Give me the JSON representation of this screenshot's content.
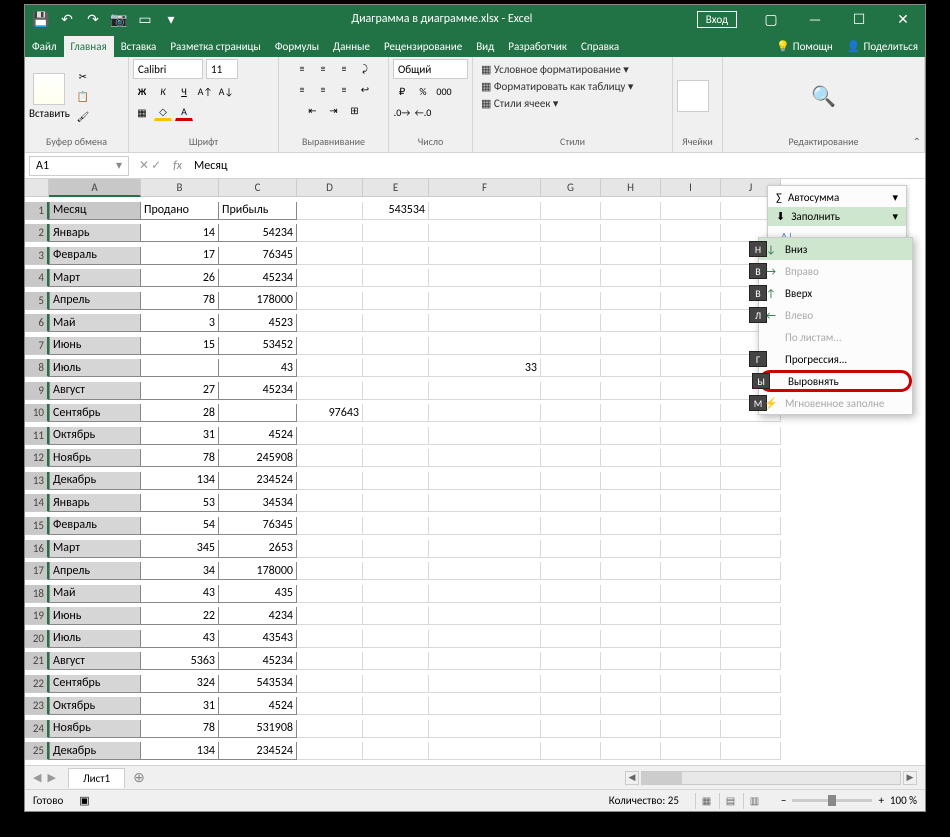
{
  "title": "Диаграмма в диаграмме.xlsx - Excel",
  "login": "Вход",
  "tabs": [
    "Файл",
    "Главная",
    "Вставка",
    "Разметка страницы",
    "Формулы",
    "Данные",
    "Рецензирование",
    "Вид",
    "Разработчик",
    "Справка"
  ],
  "active_tab": 1,
  "help_action": "Помощн",
  "share_action": "Поделиться",
  "ribbon": {
    "clipboard": {
      "paste": "Вставить",
      "label": "Буфер обмена"
    },
    "font": {
      "name": "Calibri",
      "size": "11",
      "label": "Шрифт"
    },
    "alignment": {
      "label": "Выравнивание"
    },
    "number": {
      "format": "Общий",
      "label": "Число"
    },
    "styles": {
      "cond": "Условное форматирование",
      "table": "Форматировать как таблицу",
      "cell": "Стили ячеек",
      "label": "Стили"
    },
    "cells": {
      "label": "Ячейки"
    },
    "editing": {
      "label": "Редактирование"
    }
  },
  "editing_panel": {
    "autosum": "Автосумма",
    "fill": "Заполнить",
    "sort": "Сортир"
  },
  "fill_menu": {
    "down": {
      "key": "Н",
      "label": "Вниз"
    },
    "right": {
      "key": "В",
      "label": "Вправо"
    },
    "up": {
      "key": "В",
      "label": "Вверх"
    },
    "left": {
      "key": "Л",
      "label": "Влево"
    },
    "sheets": {
      "key": "",
      "label": "По листам..."
    },
    "series": {
      "key": "Г",
      "label": "Прогрессия..."
    },
    "justify": {
      "key": "Ы",
      "label": "Выровнять"
    },
    "flash": {
      "key": "М",
      "label": "Мгновенное заполне"
    }
  },
  "namebox": "A1",
  "formula": "Месяц",
  "columns": [
    "A",
    "B",
    "C",
    "D",
    "E",
    "F",
    "G",
    "H",
    "I",
    "J"
  ],
  "sheet_data": {
    "headers": [
      "Месяц",
      "Продано",
      "Прибыль"
    ],
    "rows": [
      [
        "Январь",
        "14",
        "54234"
      ],
      [
        "Февраль",
        "17",
        "76345"
      ],
      [
        "Март",
        "26",
        "45234"
      ],
      [
        "Апрель",
        "78",
        "178000"
      ],
      [
        "Май",
        "3",
        "4523"
      ],
      [
        "Июнь",
        "15",
        "53452"
      ],
      [
        "Июль",
        "",
        "43"
      ],
      [
        "Август",
        "27",
        "45234"
      ],
      [
        "Сентябрь",
        "28",
        ""
      ],
      [
        "Октябрь",
        "31",
        "4524"
      ],
      [
        "Ноябрь",
        "78",
        "245908"
      ],
      [
        "Декабрь",
        "134",
        "234524"
      ],
      [
        "Январь",
        "53",
        "34534"
      ],
      [
        "Февраль",
        "54",
        "76345"
      ],
      [
        "Март",
        "345",
        "2653"
      ],
      [
        "Апрель",
        "34",
        "178000"
      ],
      [
        "Май",
        "43",
        "435"
      ],
      [
        "Июнь",
        "22",
        "4234"
      ],
      [
        "Июль",
        "43",
        "43543"
      ],
      [
        "Август",
        "5363",
        "45234"
      ],
      [
        "Сентябрь",
        "324",
        "543534"
      ],
      [
        "Октябрь",
        "31",
        "4524"
      ],
      [
        "Ноябрь",
        "78",
        "531908"
      ],
      [
        "Декабрь",
        "134",
        "234524"
      ]
    ],
    "other": {
      "E1": "543534",
      "D10": "97643",
      "F8": "33"
    }
  },
  "sheet_name": "Лист1",
  "status": {
    "ready": "Готово",
    "count_label": "Количество:",
    "count_val": "25",
    "zoom": "100 %"
  }
}
